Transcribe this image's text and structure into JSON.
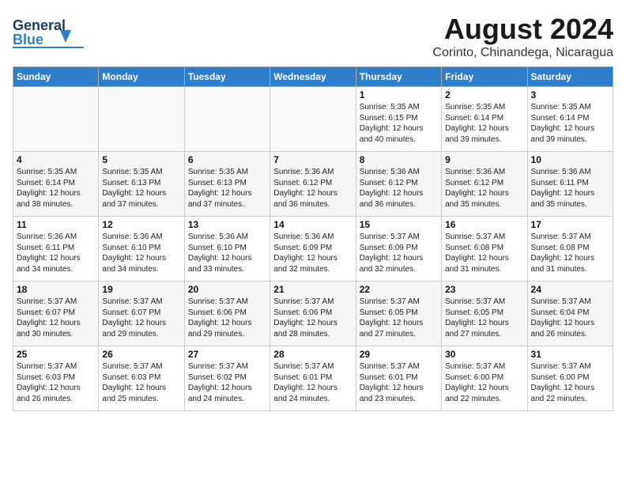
{
  "header": {
    "logo_general": "General",
    "logo_blue": "Blue",
    "main_title": "August 2024",
    "subtitle": "Corinto, Chinandega, Nicaragua"
  },
  "calendar": {
    "days_of_week": [
      "Sunday",
      "Monday",
      "Tuesday",
      "Wednesday",
      "Thursday",
      "Friday",
      "Saturday"
    ],
    "weeks": [
      [
        {
          "day": "",
          "info": ""
        },
        {
          "day": "",
          "info": ""
        },
        {
          "day": "",
          "info": ""
        },
        {
          "day": "",
          "info": ""
        },
        {
          "day": "1",
          "info": "Sunrise: 5:35 AM\nSunset: 6:15 PM\nDaylight: 12 hours\nand 40 minutes."
        },
        {
          "day": "2",
          "info": "Sunrise: 5:35 AM\nSunset: 6:14 PM\nDaylight: 12 hours\nand 39 minutes."
        },
        {
          "day": "3",
          "info": "Sunrise: 5:35 AM\nSunset: 6:14 PM\nDaylight: 12 hours\nand 39 minutes."
        }
      ],
      [
        {
          "day": "4",
          "info": "Sunrise: 5:35 AM\nSunset: 6:14 PM\nDaylight: 12 hours\nand 38 minutes."
        },
        {
          "day": "5",
          "info": "Sunrise: 5:35 AM\nSunset: 6:13 PM\nDaylight: 12 hours\nand 37 minutes."
        },
        {
          "day": "6",
          "info": "Sunrise: 5:35 AM\nSunset: 6:13 PM\nDaylight: 12 hours\nand 37 minutes."
        },
        {
          "day": "7",
          "info": "Sunrise: 5:36 AM\nSunset: 6:12 PM\nDaylight: 12 hours\nand 36 minutes."
        },
        {
          "day": "8",
          "info": "Sunrise: 5:36 AM\nSunset: 6:12 PM\nDaylight: 12 hours\nand 36 minutes."
        },
        {
          "day": "9",
          "info": "Sunrise: 5:36 AM\nSunset: 6:12 PM\nDaylight: 12 hours\nand 35 minutes."
        },
        {
          "day": "10",
          "info": "Sunrise: 5:36 AM\nSunset: 6:11 PM\nDaylight: 12 hours\nand 35 minutes."
        }
      ],
      [
        {
          "day": "11",
          "info": "Sunrise: 5:36 AM\nSunset: 6:11 PM\nDaylight: 12 hours\nand 34 minutes."
        },
        {
          "day": "12",
          "info": "Sunrise: 5:36 AM\nSunset: 6:10 PM\nDaylight: 12 hours\nand 34 minutes."
        },
        {
          "day": "13",
          "info": "Sunrise: 5:36 AM\nSunset: 6:10 PM\nDaylight: 12 hours\nand 33 minutes."
        },
        {
          "day": "14",
          "info": "Sunrise: 5:36 AM\nSunset: 6:09 PM\nDaylight: 12 hours\nand 32 minutes."
        },
        {
          "day": "15",
          "info": "Sunrise: 5:37 AM\nSunset: 6:09 PM\nDaylight: 12 hours\nand 32 minutes."
        },
        {
          "day": "16",
          "info": "Sunrise: 5:37 AM\nSunset: 6:08 PM\nDaylight: 12 hours\nand 31 minutes."
        },
        {
          "day": "17",
          "info": "Sunrise: 5:37 AM\nSunset: 6:08 PM\nDaylight: 12 hours\nand 31 minutes."
        }
      ],
      [
        {
          "day": "18",
          "info": "Sunrise: 5:37 AM\nSunset: 6:07 PM\nDaylight: 12 hours\nand 30 minutes."
        },
        {
          "day": "19",
          "info": "Sunrise: 5:37 AM\nSunset: 6:07 PM\nDaylight: 12 hours\nand 29 minutes."
        },
        {
          "day": "20",
          "info": "Sunrise: 5:37 AM\nSunset: 6:06 PM\nDaylight: 12 hours\nand 29 minutes."
        },
        {
          "day": "21",
          "info": "Sunrise: 5:37 AM\nSunset: 6:06 PM\nDaylight: 12 hours\nand 28 minutes."
        },
        {
          "day": "22",
          "info": "Sunrise: 5:37 AM\nSunset: 6:05 PM\nDaylight: 12 hours\nand 27 minutes."
        },
        {
          "day": "23",
          "info": "Sunrise: 5:37 AM\nSunset: 6:05 PM\nDaylight: 12 hours\nand 27 minutes."
        },
        {
          "day": "24",
          "info": "Sunrise: 5:37 AM\nSunset: 6:04 PM\nDaylight: 12 hours\nand 26 minutes."
        }
      ],
      [
        {
          "day": "25",
          "info": "Sunrise: 5:37 AM\nSunset: 6:03 PM\nDaylight: 12 hours\nand 26 minutes."
        },
        {
          "day": "26",
          "info": "Sunrise: 5:37 AM\nSunset: 6:03 PM\nDaylight: 12 hours\nand 25 minutes."
        },
        {
          "day": "27",
          "info": "Sunrise: 5:37 AM\nSunset: 6:02 PM\nDaylight: 12 hours\nand 24 minutes."
        },
        {
          "day": "28",
          "info": "Sunrise: 5:37 AM\nSunset: 6:01 PM\nDaylight: 12 hours\nand 24 minutes."
        },
        {
          "day": "29",
          "info": "Sunrise: 5:37 AM\nSunset: 6:01 PM\nDaylight: 12 hours\nand 23 minutes."
        },
        {
          "day": "30",
          "info": "Sunrise: 5:37 AM\nSunset: 6:00 PM\nDaylight: 12 hours\nand 22 minutes."
        },
        {
          "day": "31",
          "info": "Sunrise: 5:37 AM\nSunset: 6:00 PM\nDaylight: 12 hours\nand 22 minutes."
        }
      ]
    ]
  }
}
